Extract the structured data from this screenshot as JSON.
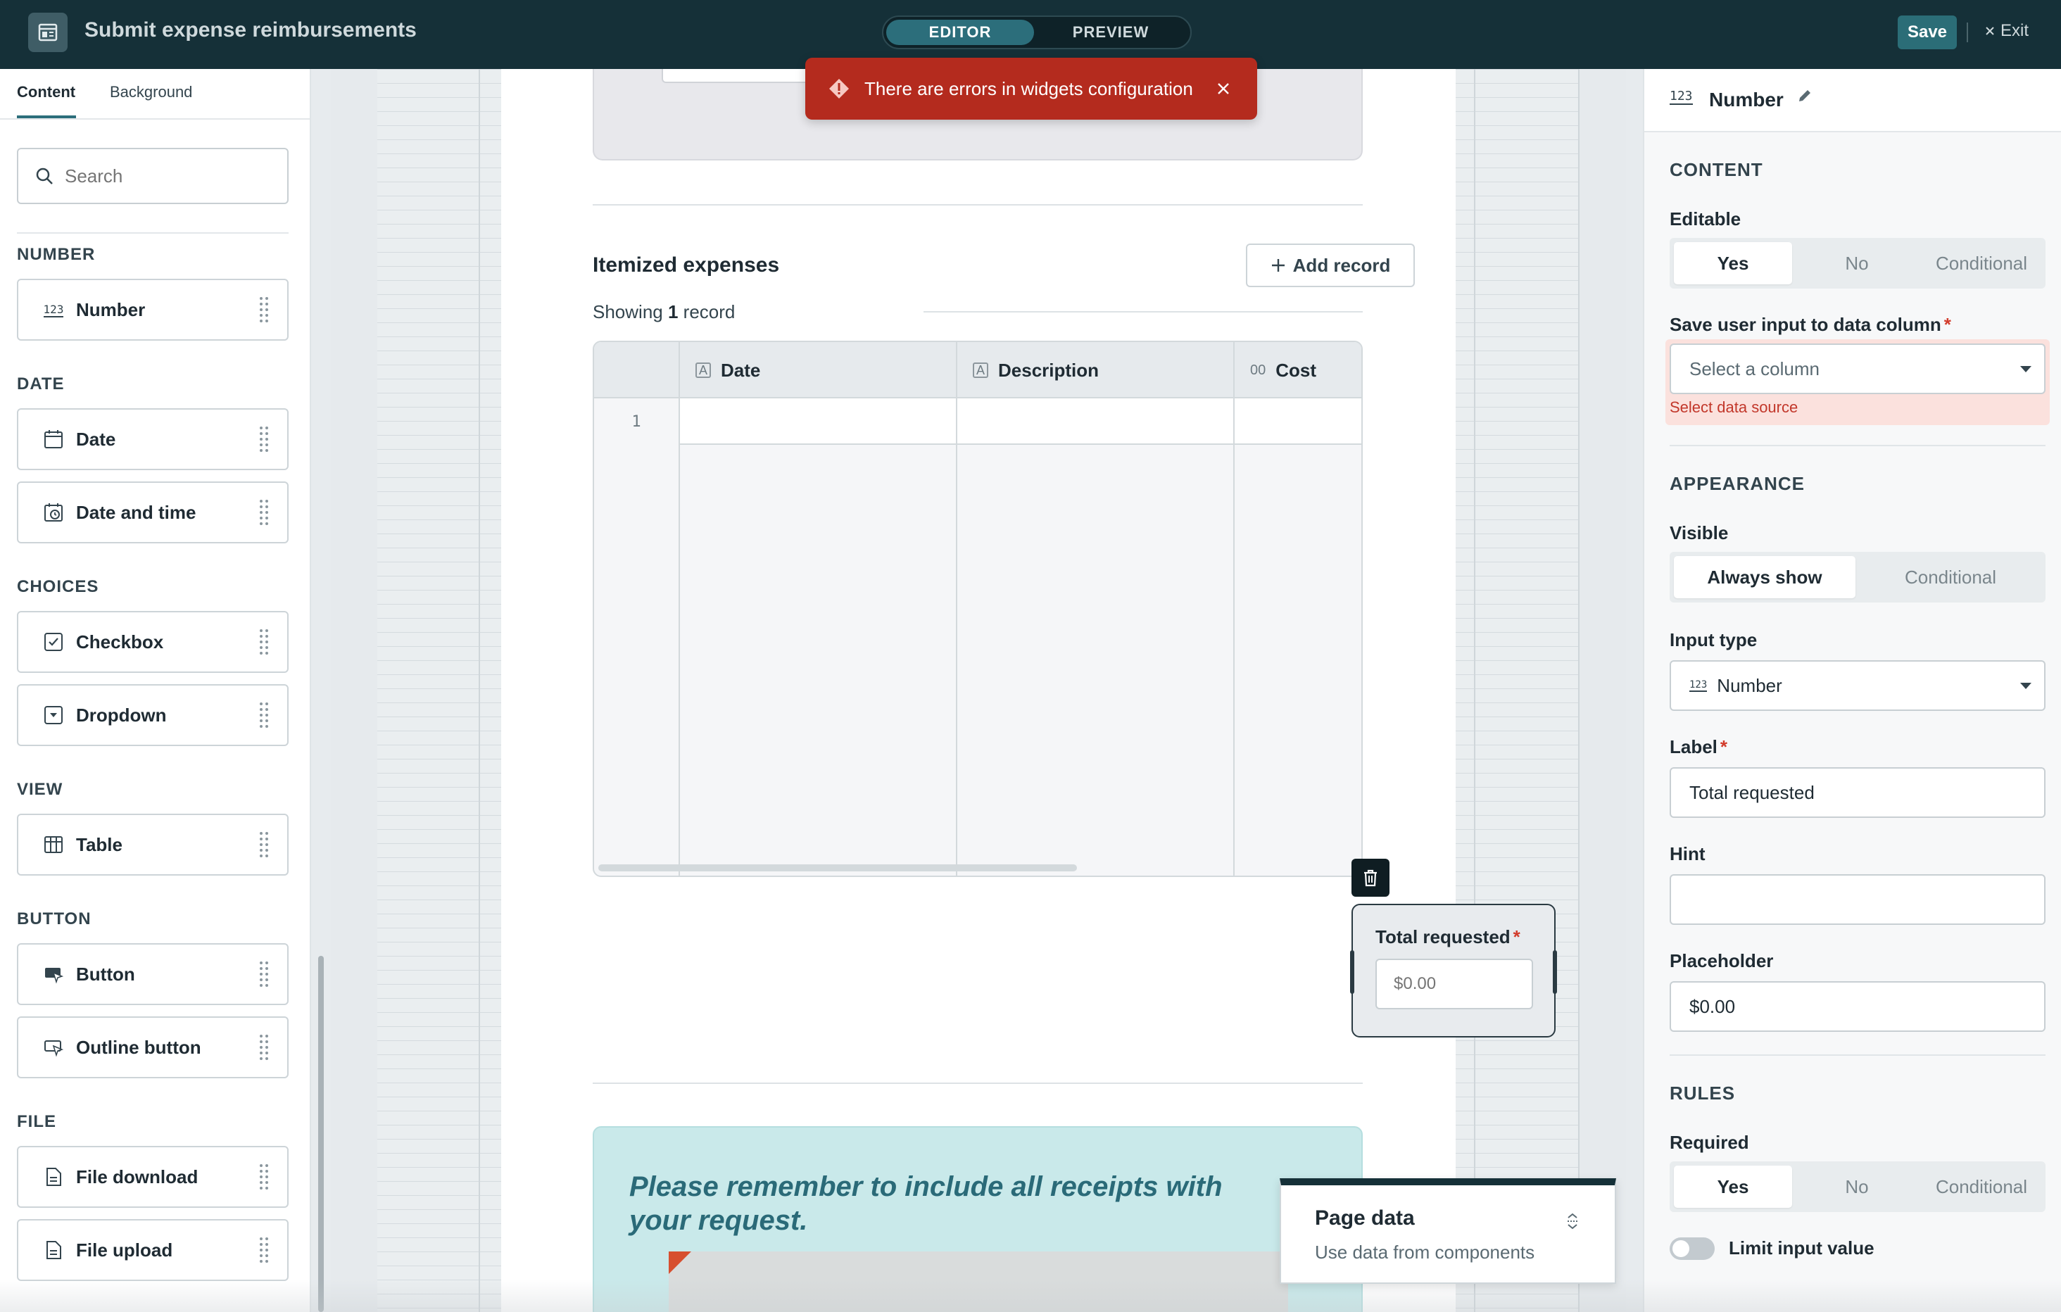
{
  "header": {
    "title": "Submit expense reimbursements",
    "mode_editor": "EDITOR",
    "mode_preview": "PREVIEW",
    "save_label": "Save",
    "exit_label": "Exit"
  },
  "left_panel": {
    "tabs": [
      "Content",
      "Background"
    ],
    "search_placeholder": "Search",
    "sections": {
      "number": "NUMBER",
      "date": "DATE",
      "choices": "CHOICES",
      "view": "VIEW",
      "button": "BUTTON",
      "file": "FILE"
    },
    "components": {
      "number": "Number",
      "date": "Date",
      "date_time": "Date and time",
      "checkbox": "Checkbox",
      "dropdown": "Dropdown",
      "table": "Table",
      "button": "Button",
      "outline_button": "Outline button",
      "file_download": "File download",
      "file_upload": "File upload"
    },
    "number_icon_text": "123"
  },
  "toast": {
    "message": "There are errors in widgets configuration"
  },
  "form": {
    "items_title": "Itemized expenses",
    "add_record": "Add record",
    "showing_prefix": "Showing",
    "showing_count": "1",
    "showing_suffix": "record",
    "table": {
      "columns": [
        "Date",
        "Description",
        "Cost"
      ],
      "col_icon_text": "A",
      "cost_icon_text": "00",
      "row_number": "1"
    },
    "number_widget": {
      "label": "Total requested",
      "required_mark": "*",
      "placeholder": "$0.00"
    },
    "note": "Please remember to include all receipts with your request."
  },
  "page_data_panel": {
    "title": "Page data",
    "subtitle": "Use data from components"
  },
  "right_panel": {
    "title": "Number",
    "icon_text": "123",
    "content_section": "CONTENT",
    "editable_label": "Editable",
    "editable_options": [
      "Yes",
      "No",
      "Conditional"
    ],
    "save_column_label": "Save user input to data column",
    "required_mark": "*",
    "select_column_placeholder": "Select a column",
    "select_source_error": "Select data source",
    "appearance_section": "APPEARANCE",
    "visible_label": "Visible",
    "visible_options": [
      "Always show",
      "Conditional"
    ],
    "input_type_label": "Input type",
    "input_type_value": "Number",
    "label_label": "Label",
    "label_value": "Total requested",
    "hint_label": "Hint",
    "hint_value": "",
    "placeholder_label": "Placeholder",
    "placeholder_value": "$0.00",
    "rules_section": "RULES",
    "required_label": "Required",
    "required_options": [
      "Yes",
      "No",
      "Conditional"
    ],
    "limit_label": "Limit input value"
  },
  "colors": {
    "header_bg": "#153038",
    "accent": "#2c6e7b",
    "error": "#b42b1e",
    "note_bg": "#c9e9ea",
    "note_text": "#2a6a78"
  }
}
